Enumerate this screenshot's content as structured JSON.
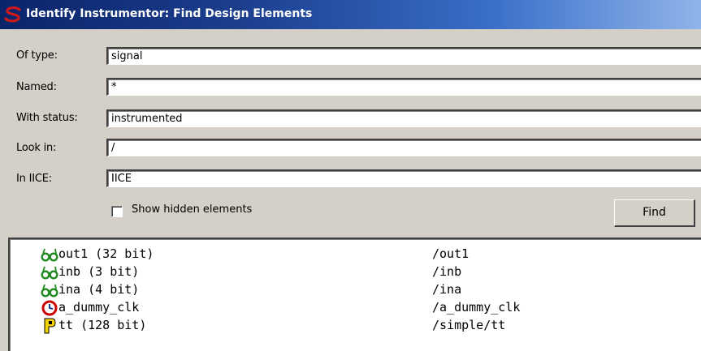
{
  "window": {
    "title": "Identify Instrumentor: Find Design Elements",
    "logo_icon": "synplicity-s-logo"
  },
  "form": {
    "of_type": {
      "label": "Of type:",
      "value": "signal"
    },
    "named": {
      "label": "Named:",
      "value": "*"
    },
    "with_status": {
      "label": "With status:",
      "value": "instrumented"
    },
    "look_in": {
      "label": "Look in:",
      "value": "/"
    },
    "in_iice": {
      "label": "In IICE:",
      "value": "IICE"
    },
    "show_hidden": {
      "label": "Show hidden elements",
      "checked": false
    },
    "find_label": "Find"
  },
  "results": [
    {
      "icon": "glasses-icon",
      "name": "out1 (32 bit)",
      "path": "/out1"
    },
    {
      "icon": "glasses-icon",
      "name": "inb (3 bit)",
      "path": "/inb"
    },
    {
      "icon": "glasses-icon",
      "name": "ina (4 bit)",
      "path": "/ina"
    },
    {
      "icon": "clock-icon",
      "name": "a_dummy_clk",
      "path": "/a_dummy_clk"
    },
    {
      "icon": "p-badge-icon",
      "name": "tt (128 bit)",
      "path": "/simple/tt"
    }
  ],
  "colors": {
    "title_start": "#0a246a",
    "title_end": "#8fb4ea",
    "window_bg": "#d4d0c8",
    "logo_red": "#cc1a1a",
    "glasses_green": "#1f8a1f",
    "clock_red": "#cc0000",
    "p_yellow": "#f2d200"
  }
}
